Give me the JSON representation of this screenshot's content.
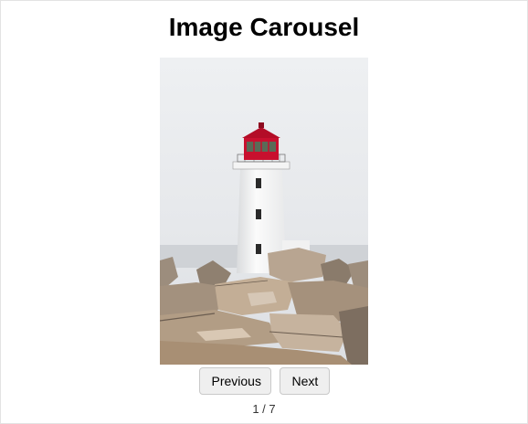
{
  "page": {
    "title": "Image Carousel"
  },
  "carousel": {
    "current_index": 1,
    "total": 7,
    "counter_text": "1 / 7",
    "image_subject": "lighthouse-on-rocks"
  },
  "controls": {
    "previous_label": "Previous",
    "next_label": "Next"
  }
}
